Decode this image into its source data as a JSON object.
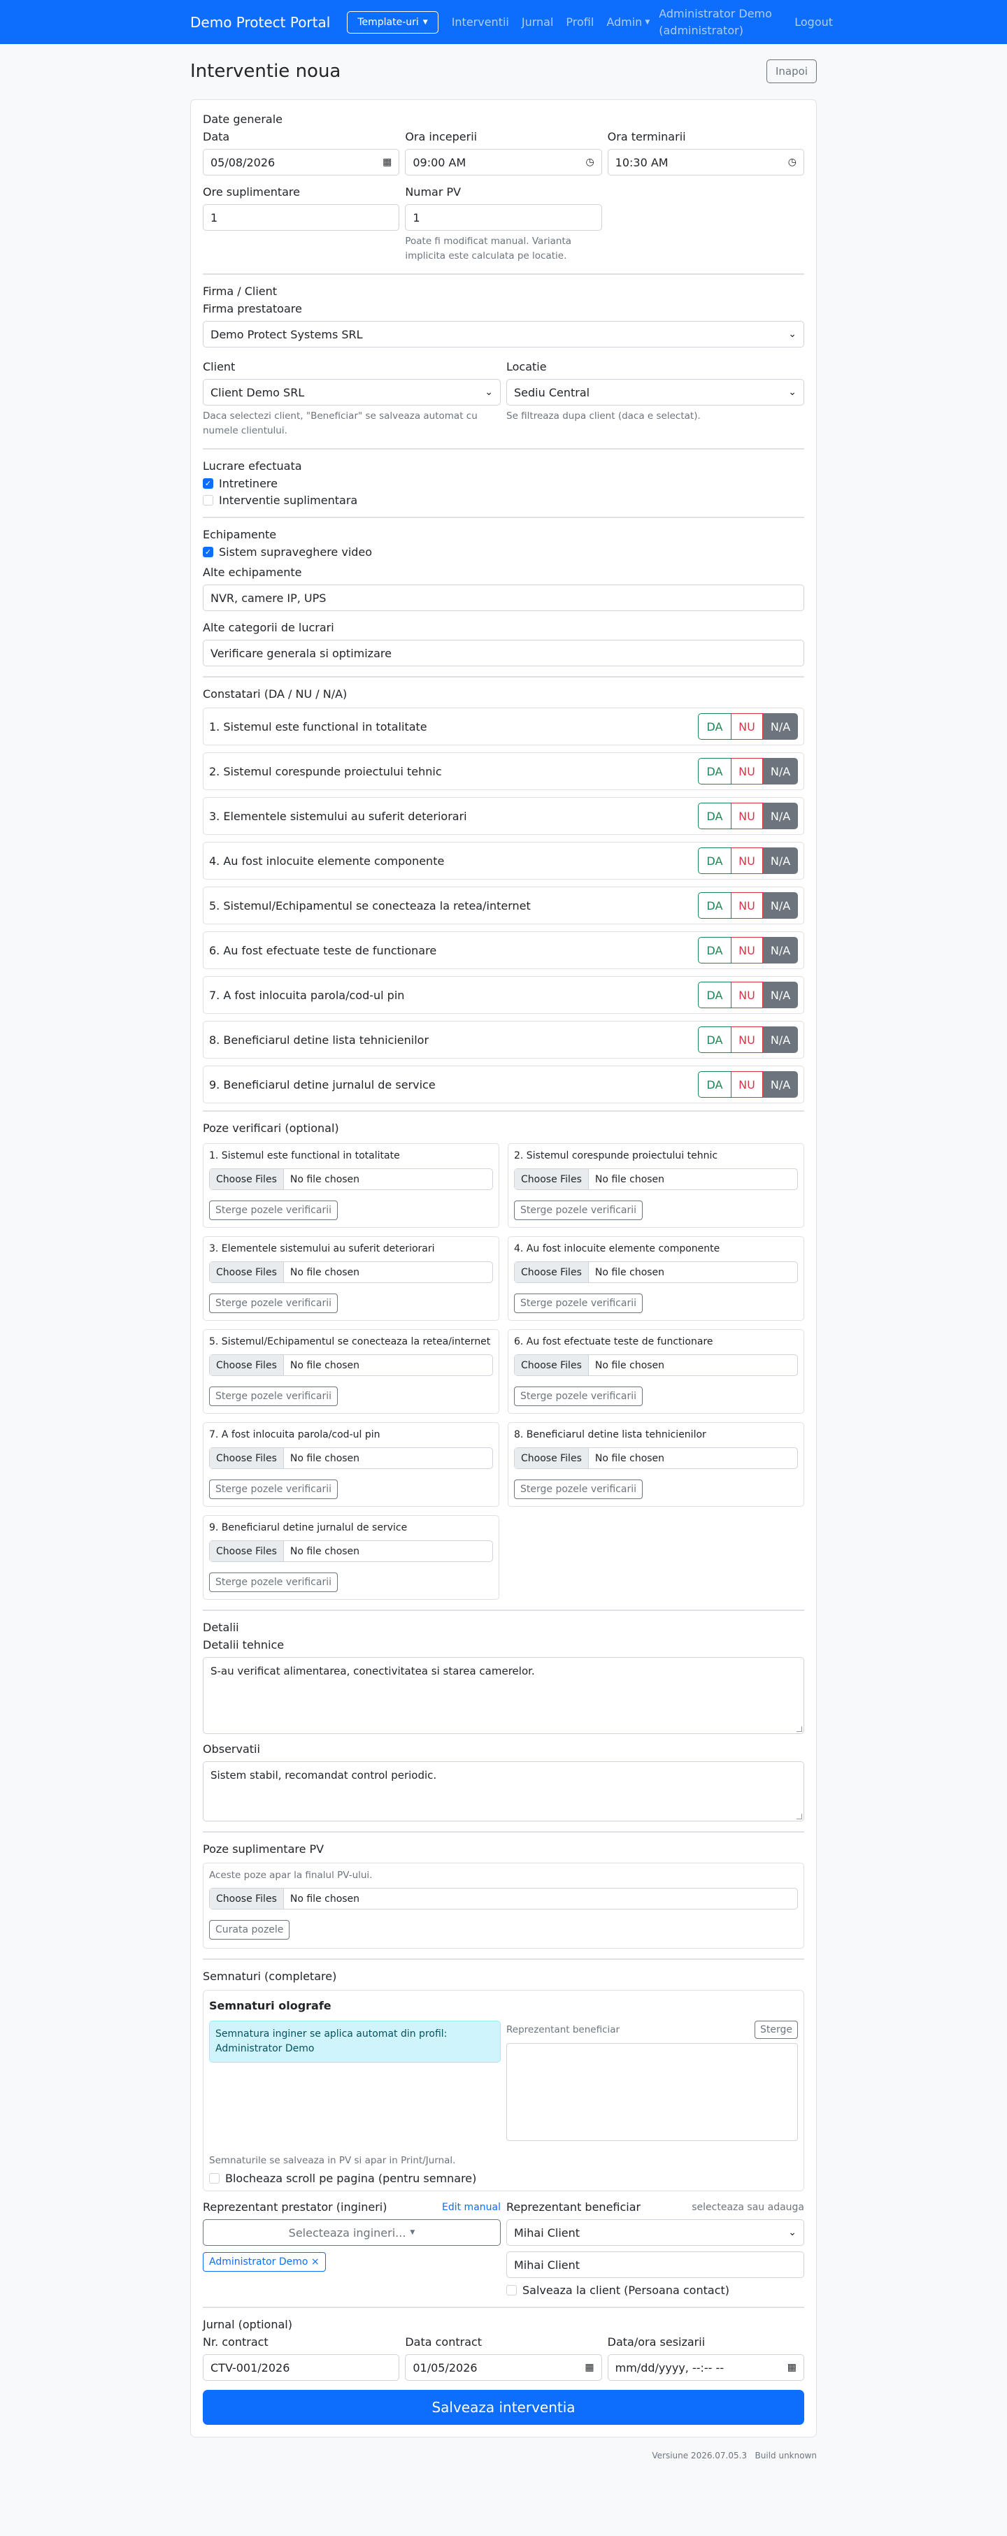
{
  "nav": {
    "brand": "Demo Protect Portal",
    "templates_btn": "Template-uri",
    "links": [
      "Interventii",
      "Jurnal",
      "Profil"
    ],
    "admin": "Admin",
    "user": "Administrator Demo (administrator)",
    "logout": "Logout"
  },
  "page": {
    "title": "Interventie noua",
    "back": "Inapoi"
  },
  "general": {
    "title": "Date generale",
    "data_label": "Data",
    "data_value": "05/08/2026",
    "start_label": "Ora inceperii",
    "start_value": "09:00 AM",
    "end_label": "Ora terminarii",
    "end_value": "10:30 AM",
    "extra_label": "Ore suplimentare",
    "extra_value": "1",
    "pv_label": "Numar PV",
    "pv_value": "1",
    "pv_help": "Poate fi modificat manual. Varianta implicita este calculata pe locatie."
  },
  "client": {
    "title": "Firma / Client",
    "firm_label": "Firma prestatoare",
    "firm_value": "Demo Protect Systems SRL",
    "client_label": "Client",
    "client_value": "Client Demo SRL",
    "client_help": "Daca selectezi client, \"Beneficiar\" se salveaza automat cu numele clientului.",
    "loc_label": "Locatie",
    "loc_value": "Sediu Central",
    "loc_help": "Se filtreaza dupa client (daca e selectat)."
  },
  "work": {
    "title": "Lucrare efectuata",
    "opt1": "Intretinere",
    "opt1_checked": true,
    "opt2": "Interventie suplimentara",
    "opt2_checked": false
  },
  "equip": {
    "title": "Echipamente",
    "opt1": "Sistem supraveghere video",
    "other_label": "Alte echipamente",
    "other_value": "NVR, camere IP, UPS",
    "cat_label": "Alte categorii de lucrari",
    "cat_value": "Verificare generala si optimizare"
  },
  "obs": {
    "title": "Constatari (DA / NU / N/A)",
    "da": "DA",
    "nu": "NU",
    "na": "N/A",
    "selected": "N/A",
    "items": [
      "1. Sistemul este functional in totalitate",
      "2. Sistemul corespunde proiectului tehnic",
      "3. Elementele sistemului au suferit deteriorari",
      "4. Au fost inlocuite elemente componente",
      "5. Sistemul/Echipamentul se conecteaza la retea/internet",
      "6. Au fost efectuate teste de functionare",
      "7. A fost inlocuita parola/cod-ul pin",
      "8. Beneficiarul detine lista tehnicienilor",
      "9. Beneficiarul detine jurnalul de service"
    ]
  },
  "photos": {
    "title": "Poze verificari (optional)",
    "choose": "Choose Files",
    "none": "No file chosen",
    "delete": "Sterge pozele verificarii",
    "items": [
      "1. Sistemul este functional in totalitate",
      "2. Sistemul corespunde proiectului tehnic",
      "3. Elementele sistemului au suferit deteriorari",
      "4. Au fost inlocuite elemente componente",
      "5. Sistemul/Echipamentul se conecteaza la retea/internet",
      "6. Au fost efectuate teste de functionare",
      "7. A fost inlocuita parola/cod-ul pin",
      "8. Beneficiarul detine lista tehnicienilor",
      "9. Beneficiarul detine jurnalul de service"
    ]
  },
  "details": {
    "title": "Detalii",
    "tech_label": "Detalii tehnice",
    "tech_value": "S-au verificat alimentarea, conectivitatea si starea camerelor.",
    "obs_label": "Observatii",
    "obs_value": "Sistem stabil, recomandat control periodic."
  },
  "extra_photos": {
    "title": "Poze suplimentare PV",
    "help": "Aceste poze apar la finalul PV-ului.",
    "choose": "Choose Files",
    "none": "No file chosen",
    "clear": "Curata pozele"
  },
  "signatures": {
    "title": "Semnaturi (completare)",
    "box_title": "Semnaturi olografe",
    "info": "Semnatura inginer se aplica automat din profil: Administrator Demo",
    "benef_label": "Reprezentant beneficiar",
    "clear": "Sterge",
    "note": "Semnaturile se salveaza in PV si apar in Print/Jurnal.",
    "lock": "Blocheaza scroll pe pagina (pentru semnare)",
    "prest_label": "Reprezentant prestator (ingineri)",
    "edit_manual": "Edit manual",
    "select_ing": "Selecteaza ingineri...",
    "badge": "Administrator Demo ×",
    "benef2_label": "Reprezentant beneficiar",
    "benef2_hint": "selecteaza sau adauga",
    "benef_select": "Mihai Client",
    "benef_input": "Mihai Client",
    "save_client": "Salveaza la client (Persoana contact)"
  },
  "journal": {
    "title": "Jurnal (optional)",
    "contract_label": "Nr. contract",
    "contract_value": "CTV-001/2026",
    "date_label": "Data contract",
    "date_value": "01/05/2026",
    "notif_label": "Data/ora sesizarii",
    "notif_value": "mm/dd/yyyy, --:-- --"
  },
  "save": "Salveaza interventia",
  "footer": "Versiune 2026.07.05.3   Build unknown"
}
